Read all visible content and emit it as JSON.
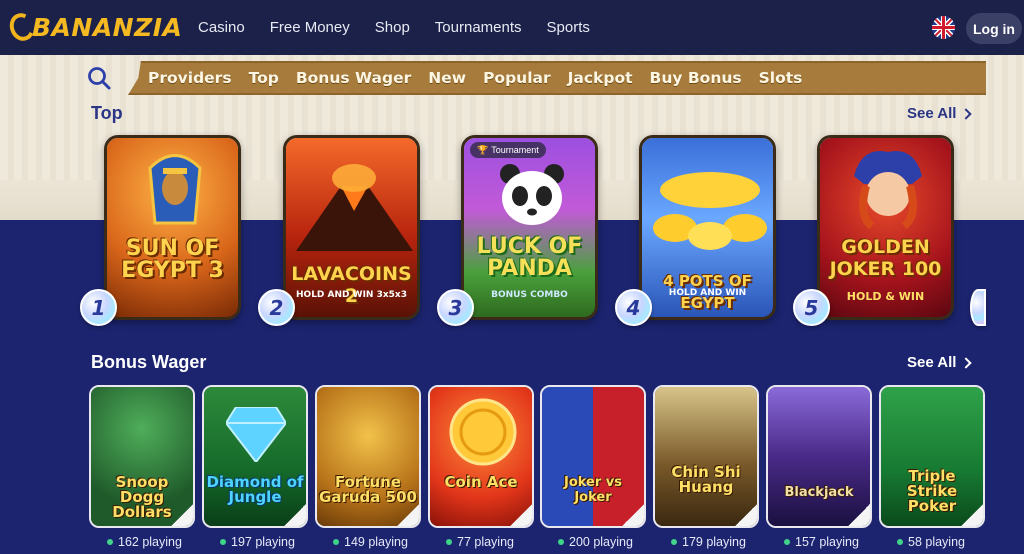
{
  "header": {
    "logo_text": "BANANZIA",
    "nav": [
      "Casino",
      "Free Money",
      "Shop",
      "Tournaments",
      "Sports"
    ],
    "login_label": "Log in",
    "flag_icon": "uk-flag-icon"
  },
  "categories": [
    "Providers",
    "Top",
    "Bonus Wager",
    "New",
    "Popular",
    "Jackpot",
    "Buy Bonus",
    "Slots"
  ],
  "top_section": {
    "title": "Top",
    "see_all": "See All",
    "games": [
      {
        "rank": "1",
        "title": "SUN OF EGYPT 3",
        "sub": ""
      },
      {
        "rank": "2",
        "title": "LAVACOINS 2",
        "sub": "HOLD AND WIN 3x5x3"
      },
      {
        "rank": "3",
        "title": "LUCK OF PANDA",
        "sub": "BONUS COMBO",
        "badge": "Tournament"
      },
      {
        "rank": "4",
        "title": "4 POTS OF EGYPT",
        "sub": "HOLD AND WIN"
      },
      {
        "rank": "5",
        "title": "GOLDEN JOKER 100",
        "sub": "HOLD & WIN"
      }
    ]
  },
  "bonus_section": {
    "title": "Bonus Wager",
    "see_all": "See All",
    "games": [
      {
        "title": "Snoop Dogg Dollars",
        "playing": "162 playing"
      },
      {
        "title": "Diamond of Jungle",
        "playing": "197 playing"
      },
      {
        "title": "Fortune Garuda 500",
        "playing": "149 playing"
      },
      {
        "title": "Coin Ace",
        "playing": "77 playing"
      },
      {
        "title": "Joker vs Joker",
        "playing": "200 playing"
      },
      {
        "title": "Chin Shi Huang",
        "playing": "179 playing"
      },
      {
        "title": "Blackjack",
        "playing": "157 playing"
      },
      {
        "title": "Triple Strike Poker",
        "playing": "58 playing"
      }
    ]
  },
  "colors": {
    "header_bg": "#1b2149",
    "body_bg": "#1c2470",
    "accent_gold": "#f5b921",
    "section_title_light": "#2a3585",
    "section_title_dark": "#ffffff"
  }
}
